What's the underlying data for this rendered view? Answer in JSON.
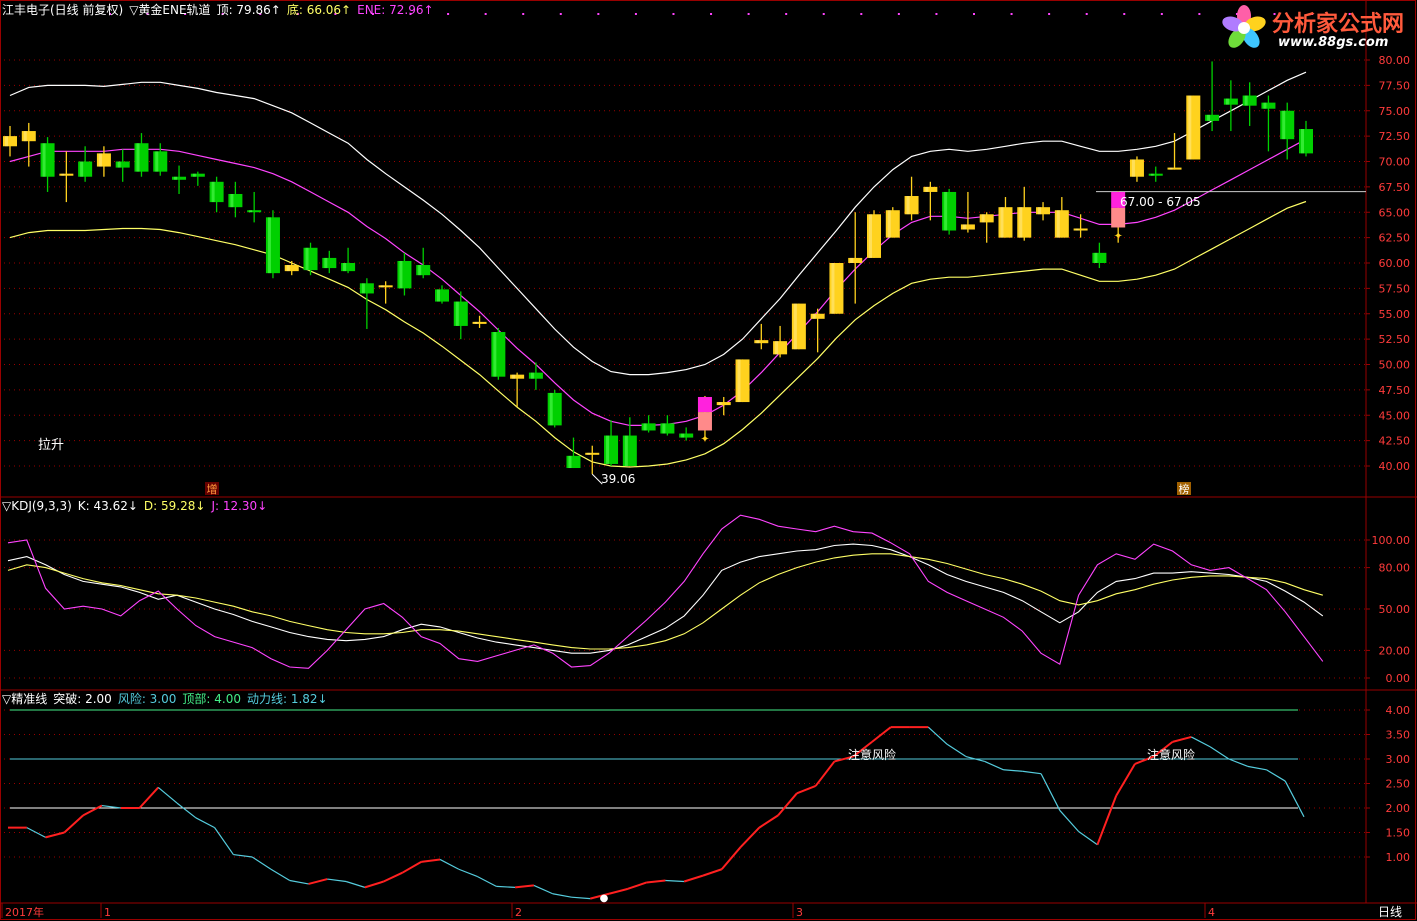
{
  "main_panel": {
    "title_items": [
      {
        "text": "江丰电子(日线 前复权)",
        "color": "#ffffff"
      },
      {
        "text": "▽黄金ENE轨道",
        "color": "#ffffff"
      },
      {
        "text": "顶: 79.86↑",
        "color": "#ffffff"
      },
      {
        "text": "底: 66.06↑",
        "color": "#ffff66"
      },
      {
        "text": "ENE: 72.96↑",
        "color": "#ff44ff"
      }
    ],
    "left_label": "拉升",
    "low_marker": "39.06",
    "price_annotation": "67.00 - 67.05",
    "marker_a": "增",
    "marker_b": "榜",
    "y_ticks": [
      "80.00",
      "77.50",
      "75.00",
      "72.50",
      "70.00",
      "67.50",
      "65.00",
      "62.50",
      "60.00",
      "57.50",
      "55.00",
      "52.50",
      "50.00",
      "47.50",
      "45.00",
      "42.50",
      "40.00"
    ]
  },
  "kdj_panel": {
    "title_items": [
      {
        "text": "▽KDJ(9,3,3)",
        "color": "#ffffff"
      },
      {
        "text": "K: 43.62↓",
        "color": "#ffffff"
      },
      {
        "text": "D: 59.28↓",
        "color": "#ffff66"
      },
      {
        "text": "J: 12.30↓",
        "color": "#ff44ff"
      }
    ],
    "y_ticks": [
      "100.00",
      "80.00",
      "50.00",
      "20.00",
      "0.00"
    ]
  },
  "jz_panel": {
    "title_items": [
      {
        "text": "▽精准线",
        "color": "#ffffff"
      },
      {
        "text": "突破: 2.00",
        "color": "#ffffff"
      },
      {
        "text": "风险: 3.00",
        "color": "#55ccdd"
      },
      {
        "text": "顶部: 4.00",
        "color": "#44ee88"
      },
      {
        "text": "动力线: 1.82↓",
        "color": "#55ccdd"
      }
    ],
    "warn_label": "注意风险",
    "y_ticks": [
      "4.00",
      "3.50",
      "3.00",
      "2.50",
      "2.00",
      "1.50",
      "1.00"
    ]
  },
  "bottom_axis": {
    "labels": [
      "2017年",
      "1",
      "2",
      "3",
      "4"
    ],
    "period": "日线"
  },
  "logo": {
    "text": "分析家公式网",
    "url_text": "www.88gs.com"
  },
  "colors": {
    "up": "#ffd21e",
    "down": "#00d000",
    "upper": "#ffffff",
    "mid": "#ff44ff",
    "lower": "#ffff66",
    "grid": "#990000",
    "cyan": "#55ccdd",
    "red_line": "#ff2020",
    "top_line": "#44ee88"
  },
  "chart_data": [
    {
      "type": "candlestick",
      "title": "江丰电子(日线 前复权)",
      "ylim": [
        38,
        82
      ],
      "candles": [
        {
          "o": 71.5,
          "h": 73.5,
          "l": 70.5,
          "c": 72.5
        },
        {
          "o": 72.0,
          "h": 73.8,
          "l": 69.5,
          "c": 73.0
        },
        {
          "o": 71.8,
          "h": 72.4,
          "l": 67.0,
          "c": 68.5
        },
        {
          "o": 68.6,
          "h": 71.0,
          "l": 66.0,
          "c": 68.8
        },
        {
          "o": 70.0,
          "h": 71.5,
          "l": 68.0,
          "c": 68.5
        },
        {
          "o": 69.5,
          "h": 71.5,
          "l": 68.5,
          "c": 70.8
        },
        {
          "o": 70.0,
          "h": 71.2,
          "l": 68.0,
          "c": 69.4
        },
        {
          "o": 71.8,
          "h": 72.8,
          "l": 68.5,
          "c": 69.0
        },
        {
          "o": 71.0,
          "h": 71.8,
          "l": 68.6,
          "c": 69.0
        },
        {
          "o": 68.5,
          "h": 69.6,
          "l": 66.8,
          "c": 68.2
        },
        {
          "o": 68.8,
          "h": 69.0,
          "l": 67.6,
          "c": 68.5
        },
        {
          "o": 68.0,
          "h": 68.5,
          "l": 65.0,
          "c": 66.0
        },
        {
          "o": 66.8,
          "h": 68.0,
          "l": 64.5,
          "c": 65.5
        },
        {
          "o": 65.2,
          "h": 67.0,
          "l": 64.0,
          "c": 65.0
        },
        {
          "o": 64.5,
          "h": 65.2,
          "l": 58.5,
          "c": 59.0
        },
        {
          "o": 59.2,
          "h": 60.2,
          "l": 58.8,
          "c": 59.8
        },
        {
          "o": 61.5,
          "h": 62.0,
          "l": 58.8,
          "c": 59.3
        },
        {
          "o": 60.5,
          "h": 61.2,
          "l": 59.0,
          "c": 59.5
        },
        {
          "o": 60.0,
          "h": 61.5,
          "l": 59.0,
          "c": 59.2
        },
        {
          "o": 58.0,
          "h": 58.5,
          "l": 53.5,
          "c": 57.0
        },
        {
          "o": 57.8,
          "h": 58.2,
          "l": 56.0,
          "c": 57.8
        },
        {
          "o": 60.2,
          "h": 61.0,
          "l": 56.8,
          "c": 57.5
        },
        {
          "o": 59.8,
          "h": 61.5,
          "l": 58.5,
          "c": 58.8
        },
        {
          "o": 57.4,
          "h": 57.8,
          "l": 56.0,
          "c": 56.2
        },
        {
          "o": 56.2,
          "h": 57.2,
          "l": 52.5,
          "c": 53.8
        },
        {
          "o": 54.0,
          "h": 54.8,
          "l": 53.6,
          "c": 54.2
        },
        {
          "o": 53.2,
          "h": 53.6,
          "l": 48.5,
          "c": 48.8
        },
        {
          "o": 48.6,
          "h": 49.2,
          "l": 45.8,
          "c": 49.0
        },
        {
          "o": 49.2,
          "h": 50.2,
          "l": 47.5,
          "c": 48.6
        },
        {
          "o": 47.2,
          "h": 47.5,
          "l": 43.8,
          "c": 44.0
        },
        {
          "o": 41.0,
          "h": 42.8,
          "l": 39.8,
          "c": 39.8
        },
        {
          "o": 41.2,
          "h": 42.0,
          "l": 39.2,
          "c": 41.3
        },
        {
          "o": 43.0,
          "h": 44.5,
          "l": 40.0,
          "c": 40.2
        },
        {
          "o": 43.0,
          "h": 44.8,
          "l": 40.0,
          "c": 40.0
        },
        {
          "o": 44.2,
          "h": 45.0,
          "l": 43.3,
          "c": 43.5
        },
        {
          "o": 44.2,
          "h": 45.0,
          "l": 43.0,
          "c": 43.2
        },
        {
          "o": 43.2,
          "h": 43.8,
          "l": 42.5,
          "c": 42.8
        },
        {
          "o": 43.5,
          "h": 46.9,
          "l": 42.6,
          "c": 46.8
        },
        {
          "o": 46.0,
          "h": 46.8,
          "l": 45.0,
          "c": 46.3
        },
        {
          "o": 46.3,
          "h": 50.5,
          "l": 46.3,
          "c": 50.5
        },
        {
          "o": 52.1,
          "h": 54.0,
          "l": 51.5,
          "c": 52.4
        },
        {
          "o": 51.0,
          "h": 53.8,
          "l": 50.7,
          "c": 52.3
        },
        {
          "o": 51.5,
          "h": 56.0,
          "l": 51.5,
          "c": 56.0
        },
        {
          "o": 54.5,
          "h": 55.5,
          "l": 51.2,
          "c": 55.0
        },
        {
          "o": 55.0,
          "h": 60.0,
          "l": 55.0,
          "c": 60.0
        },
        {
          "o": 60.0,
          "h": 65.0,
          "l": 56.0,
          "c": 60.5
        },
        {
          "o": 60.5,
          "h": 65.2,
          "l": 60.5,
          "c": 64.8
        },
        {
          "o": 62.5,
          "h": 65.5,
          "l": 62.5,
          "c": 65.2
        },
        {
          "o": 64.8,
          "h": 68.5,
          "l": 64.2,
          "c": 66.6
        },
        {
          "o": 67.0,
          "h": 68.0,
          "l": 64.2,
          "c": 67.5
        },
        {
          "o": 67.0,
          "h": 67.3,
          "l": 62.8,
          "c": 63.2
        },
        {
          "o": 63.3,
          "h": 67.0,
          "l": 63.0,
          "c": 63.8
        },
        {
          "o": 64.0,
          "h": 65.0,
          "l": 62.0,
          "c": 64.8
        },
        {
          "o": 62.5,
          "h": 66.5,
          "l": 62.5,
          "c": 65.5
        },
        {
          "o": 62.5,
          "h": 67.5,
          "l": 62.2,
          "c": 65.5
        },
        {
          "o": 64.8,
          "h": 66.0,
          "l": 64.2,
          "c": 65.5
        },
        {
          "o": 62.5,
          "h": 66.5,
          "l": 62.5,
          "c": 65.2
        },
        {
          "o": 63.2,
          "h": 64.8,
          "l": 62.5,
          "c": 63.4
        },
        {
          "o": 61.0,
          "h": 62.0,
          "l": 59.5,
          "c": 60.0
        },
        {
          "o": 63.5,
          "h": 67.05,
          "l": 62.0,
          "c": 67.0
        },
        {
          "o": 68.5,
          "h": 70.5,
          "l": 68.0,
          "c": 70.2
        },
        {
          "o": 68.8,
          "h": 69.5,
          "l": 68.0,
          "c": 68.6
        },
        {
          "o": 69.2,
          "h": 72.8,
          "l": 69.2,
          "c": 69.4
        },
        {
          "o": 70.2,
          "h": 76.5,
          "l": 70.2,
          "c": 76.5
        },
        {
          "o": 74.6,
          "h": 79.86,
          "l": 73.0,
          "c": 74.0
        },
        {
          "o": 76.2,
          "h": 78.0,
          "l": 73.0,
          "c": 75.6
        },
        {
          "o": 76.5,
          "h": 77.8,
          "l": 73.5,
          "c": 75.5
        },
        {
          "o": 75.8,
          "h": 76.5,
          "l": 71.0,
          "c": 75.2
        },
        {
          "o": 75.0,
          "h": 75.8,
          "l": 70.2,
          "c": 72.2
        },
        {
          "o": 73.2,
          "h": 74.0,
          "l": 70.5,
          "c": 70.8
        }
      ],
      "ene_upper": [
        76.5,
        77.3,
        77.5,
        77.5,
        77.5,
        77.4,
        77.6,
        77.8,
        77.8,
        77.5,
        77.2,
        76.8,
        76.5,
        76.2,
        75.5,
        74.8,
        73.8,
        72.8,
        71.8,
        70.2,
        68.8,
        67.5,
        66.2,
        64.8,
        63.2,
        61.5,
        59.5,
        57.5,
        55.5,
        53.5,
        51.7,
        50.3,
        49.3,
        49.0,
        49.0,
        49.2,
        49.5,
        50.0,
        51.0,
        52.5,
        54.5,
        56.5,
        58.8,
        61.0,
        63.2,
        65.5,
        67.5,
        69.2,
        70.5,
        71.0,
        71.2,
        71.0,
        71.2,
        71.5,
        71.8,
        72.0,
        72.0,
        71.5,
        71.0,
        71.0,
        71.2,
        71.5,
        72.0,
        73.0,
        74.0,
        75.0,
        76.0,
        77.0,
        78.0,
        78.8
      ],
      "ene_mid": [
        70.0,
        70.5,
        71.0,
        71.0,
        71.0,
        71.0,
        71.2,
        71.2,
        71.2,
        71.0,
        70.6,
        70.2,
        69.8,
        69.4,
        68.8,
        68.0,
        67.0,
        66.0,
        65.0,
        63.6,
        62.4,
        61.0,
        59.8,
        58.4,
        56.8,
        55.2,
        53.4,
        51.6,
        50.0,
        48.2,
        46.5,
        45.2,
        44.4,
        44.0,
        44.0,
        44.1,
        44.4,
        45.0,
        46.0,
        47.4,
        49.2,
        51.2,
        53.2,
        55.2,
        57.4,
        59.4,
        61.2,
        62.8,
        64.0,
        64.6,
        64.6,
        64.4,
        64.6,
        64.8,
        65.0,
        65.0,
        65.0,
        64.4,
        63.8,
        63.8,
        64.0,
        64.5,
        65.2,
        66.2,
        67.2,
        68.2,
        69.2,
        70.2,
        71.2,
        72.2
      ],
      "ene_lower": [
        62.5,
        63.0,
        63.2,
        63.2,
        63.2,
        63.3,
        63.4,
        63.4,
        63.3,
        63.0,
        62.6,
        62.2,
        61.8,
        61.3,
        60.8,
        60.0,
        59.2,
        58.4,
        57.6,
        56.4,
        55.4,
        54.2,
        53.1,
        51.8,
        50.4,
        49.0,
        47.4,
        45.8,
        44.4,
        42.8,
        41.4,
        40.4,
        40.0,
        39.9,
        40.0,
        40.2,
        40.6,
        41.2,
        42.2,
        43.6,
        45.2,
        47.0,
        48.8,
        50.6,
        52.6,
        54.4,
        55.8,
        57.0,
        58.0,
        58.4,
        58.6,
        58.6,
        58.8,
        59.0,
        59.2,
        59.4,
        59.4,
        58.8,
        58.2,
        58.2,
        58.4,
        58.8,
        59.4,
        60.4,
        61.4,
        62.4,
        63.4,
        64.4,
        65.4,
        66.06
      ]
    },
    {
      "type": "line",
      "title": "KDJ(9,3,3)",
      "ylim": [
        -5,
        115
      ],
      "series": [
        {
          "name": "K",
          "values": [
            85,
            88,
            82,
            75,
            70,
            68,
            66,
            62,
            57,
            60,
            55,
            50,
            46,
            41,
            37,
            33,
            30,
            28,
            27,
            28,
            30,
            35,
            39,
            37,
            33,
            29,
            26,
            24,
            22,
            20,
            18,
            18,
            20,
            24,
            30,
            36,
            45,
            60,
            78,
            84,
            88,
            90,
            92,
            93,
            96,
            97,
            96,
            93,
            88,
            82,
            75,
            70,
            66,
            62,
            56,
            48,
            40,
            48,
            62,
            70,
            72,
            76,
            76,
            77,
            76,
            75,
            73,
            70,
            63,
            55,
            45
          ]
        },
        {
          "name": "D",
          "values": [
            78,
            82,
            80,
            76,
            72,
            69,
            67,
            64,
            61,
            60,
            58,
            55,
            52,
            48,
            45,
            41,
            38,
            35,
            33,
            32,
            32,
            33,
            35,
            35,
            34,
            32,
            30,
            28,
            26,
            24,
            22,
            21,
            21,
            22,
            24,
            27,
            32,
            40,
            50,
            60,
            69,
            75,
            80,
            84,
            87,
            89,
            90,
            90,
            88,
            86,
            83,
            79,
            75,
            72,
            68,
            63,
            56,
            53,
            56,
            61,
            64,
            68,
            71,
            73,
            74,
            74,
            73,
            72,
            69,
            64,
            60
          ]
        },
        {
          "name": "J",
          "values": [
            98,
            100,
            65,
            50,
            52,
            50,
            45,
            56,
            63,
            50,
            38,
            30,
            26,
            22,
            14,
            8,
            7,
            20,
            35,
            50,
            54,
            44,
            30,
            25,
            14,
            12,
            16,
            20,
            24,
            18,
            8,
            9,
            18,
            30,
            42,
            55,
            70,
            90,
            108,
            118,
            115,
            110,
            108,
            106,
            110,
            106,
            105,
            98,
            90,
            70,
            62,
            56,
            50,
            44,
            34,
            18,
            10,
            60,
            82,
            90,
            86,
            97,
            92,
            82,
            78,
            80,
            72,
            64,
            48,
            30,
            12
          ]
        }
      ]
    },
    {
      "type": "line",
      "title": "精准线",
      "ylim": [
        0.6,
        4.25
      ],
      "reference_lines": [
        {
          "name": "突破",
          "value": 2.0
        },
        {
          "name": "风险",
          "value": 3.0
        },
        {
          "name": "顶部",
          "value": 4.0
        }
      ],
      "series": [
        {
          "name": "动力线",
          "values": [
            1.6,
            1.6,
            1.4,
            1.5,
            1.85,
            2.05,
            2.0,
            2.0,
            2.42,
            2.1,
            1.8,
            1.6,
            1.05,
            1.0,
            0.75,
            0.52,
            0.45,
            0.55,
            0.5,
            0.38,
            0.5,
            0.68,
            0.9,
            0.95,
            0.75,
            0.6,
            0.4,
            0.38,
            0.42,
            0.25,
            0.18,
            0.15,
            0.25,
            0.35,
            0.48,
            0.52,
            0.5,
            0.62,
            0.75,
            1.2,
            1.6,
            1.85,
            2.3,
            2.45,
            2.95,
            3.05,
            3.35,
            3.65,
            3.65,
            3.65,
            3.3,
            3.05,
            2.95,
            2.78,
            2.75,
            2.7,
            1.95,
            1.52,
            1.25,
            2.25,
            2.9,
            3.05,
            3.35,
            3.45,
            3.25,
            3.0,
            2.85,
            2.78,
            2.55,
            1.82
          ]
        }
      ]
    }
  ]
}
